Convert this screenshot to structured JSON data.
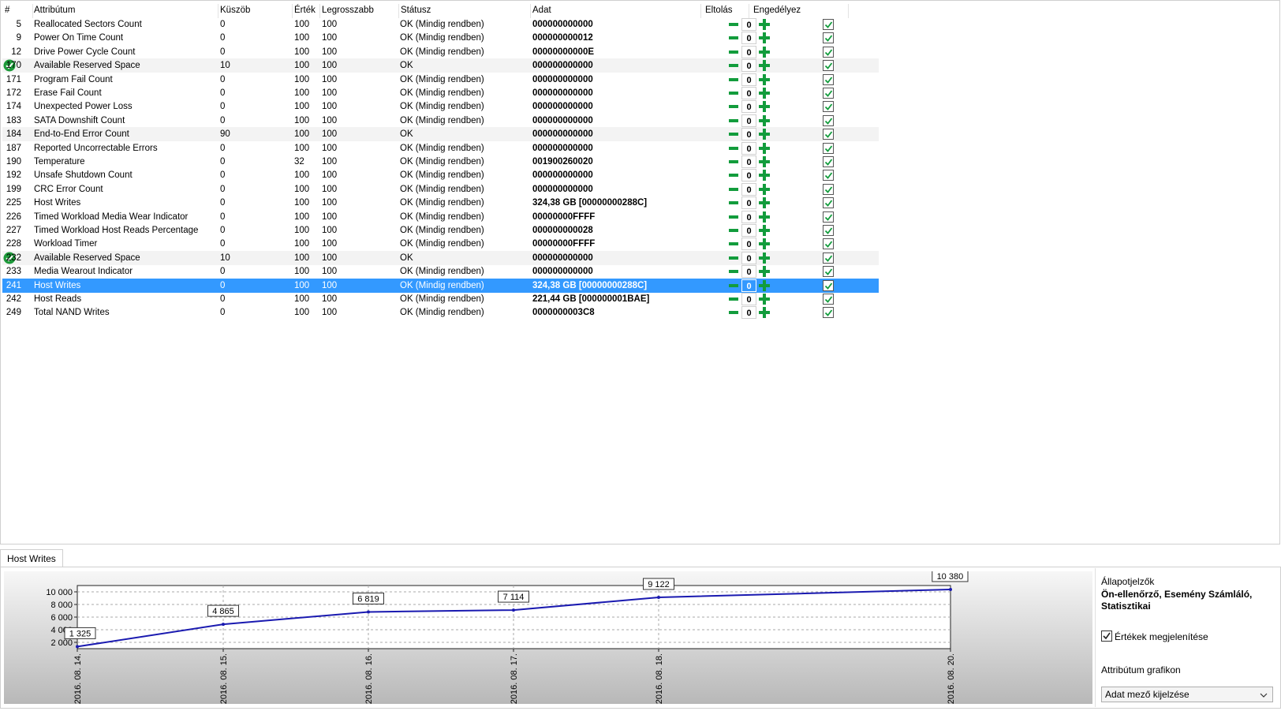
{
  "columns": [
    "#",
    "Attribútum",
    "Küszöb",
    "Érték",
    "Legrosszabb",
    "Státusz",
    "Adat",
    "Eltolás",
    "Engedélyez"
  ],
  "rows": [
    {
      "id": "5",
      "name": "Reallocated Sectors Count",
      "threshold": "0",
      "value": "100",
      "worst": "100",
      "status": "OK (Mindig rendben)",
      "data": "000000000000",
      "offset": "0",
      "enabled": true
    },
    {
      "id": "9",
      "name": "Power On Time Count",
      "threshold": "0",
      "value": "100",
      "worst": "100",
      "status": "OK (Mindig rendben)",
      "data": "000000000012",
      "offset": "0",
      "enabled": true
    },
    {
      "id": "12",
      "name": "Drive Power Cycle Count",
      "threshold": "0",
      "value": "100",
      "worst": "100",
      "status": "OK (Mindig rendben)",
      "data": "00000000000E",
      "offset": "0",
      "enabled": true
    },
    {
      "id": "170",
      "name": "Available Reserved Space",
      "threshold": "10",
      "value": "100",
      "worst": "100",
      "status": "OK",
      "data": "000000000000",
      "offset": "0",
      "enabled": true,
      "status_icon": "check-circle-icon"
    },
    {
      "id": "171",
      "name": "Program Fail Count",
      "threshold": "0",
      "value": "100",
      "worst": "100",
      "status": "OK (Mindig rendben)",
      "data": "000000000000",
      "offset": "0",
      "enabled": true
    },
    {
      "id": "172",
      "name": "Erase Fail Count",
      "threshold": "0",
      "value": "100",
      "worst": "100",
      "status": "OK (Mindig rendben)",
      "data": "000000000000",
      "offset": "0",
      "enabled": true
    },
    {
      "id": "174",
      "name": "Unexpected Power Loss",
      "threshold": "0",
      "value": "100",
      "worst": "100",
      "status": "OK (Mindig rendben)",
      "data": "000000000000",
      "offset": "0",
      "enabled": true
    },
    {
      "id": "183",
      "name": "SATA Downshift Count",
      "threshold": "0",
      "value": "100",
      "worst": "100",
      "status": "OK (Mindig rendben)",
      "data": "000000000000",
      "offset": "0",
      "enabled": true
    },
    {
      "id": "184",
      "name": "End-to-End Error Count",
      "threshold": "90",
      "value": "100",
      "worst": "100",
      "status": "OK",
      "data": "000000000000",
      "offset": "0",
      "enabled": true
    },
    {
      "id": "187",
      "name": "Reported Uncorrectable Errors",
      "threshold": "0",
      "value": "100",
      "worst": "100",
      "status": "OK (Mindig rendben)",
      "data": "000000000000",
      "offset": "0",
      "enabled": true
    },
    {
      "id": "190",
      "name": "Temperature",
      "threshold": "0",
      "value": "32",
      "worst": "100",
      "status": "OK (Mindig rendben)",
      "data": "001900260020",
      "offset": "0",
      "enabled": true
    },
    {
      "id": "192",
      "name": "Unsafe Shutdown Count",
      "threshold": "0",
      "value": "100",
      "worst": "100",
      "status": "OK (Mindig rendben)",
      "data": "000000000000",
      "offset": "0",
      "enabled": true
    },
    {
      "id": "199",
      "name": "CRC Error Count",
      "threshold": "0",
      "value": "100",
      "worst": "100",
      "status": "OK (Mindig rendben)",
      "data": "000000000000",
      "offset": "0",
      "enabled": true
    },
    {
      "id": "225",
      "name": "Host Writes",
      "threshold": "0",
      "value": "100",
      "worst": "100",
      "status": "OK (Mindig rendben)",
      "data": "324,38 GB [00000000288C]",
      "offset": "0",
      "enabled": true
    },
    {
      "id": "226",
      "name": "Timed Workload Media Wear Indicator",
      "threshold": "0",
      "value": "100",
      "worst": "100",
      "status": "OK (Mindig rendben)",
      "data": "00000000FFFF",
      "offset": "0",
      "enabled": true
    },
    {
      "id": "227",
      "name": "Timed Workload Host Reads Percentage",
      "threshold": "0",
      "value": "100",
      "worst": "100",
      "status": "OK (Mindig rendben)",
      "data": "000000000028",
      "offset": "0",
      "enabled": true
    },
    {
      "id": "228",
      "name": "Workload Timer",
      "threshold": "0",
      "value": "100",
      "worst": "100",
      "status": "OK (Mindig rendben)",
      "data": "00000000FFFF",
      "offset": "0",
      "enabled": true
    },
    {
      "id": "232",
      "name": "Available Reserved Space",
      "threshold": "10",
      "value": "100",
      "worst": "100",
      "status": "OK",
      "data": "000000000000",
      "offset": "0",
      "enabled": true,
      "status_icon": "check-circle-icon"
    },
    {
      "id": "233",
      "name": "Media Wearout Indicator",
      "threshold": "0",
      "value": "100",
      "worst": "100",
      "status": "OK (Mindig rendben)",
      "data": "000000000000",
      "offset": "0",
      "enabled": true
    },
    {
      "id": "241",
      "name": "Host Writes",
      "threshold": "0",
      "value": "100",
      "worst": "100",
      "status": "OK (Mindig rendben)",
      "data": "324,38 GB [00000000288C]",
      "offset": "0",
      "enabled": true,
      "selected": true
    },
    {
      "id": "242",
      "name": "Host Reads",
      "threshold": "0",
      "value": "100",
      "worst": "100",
      "status": "OK (Mindig rendben)",
      "data": "221,44 GB [000000001BAE]",
      "offset": "0",
      "enabled": true
    },
    {
      "id": "249",
      "name": "Total NAND Writes",
      "threshold": "0",
      "value": "100",
      "worst": "100",
      "status": "OK (Mindig rendben)",
      "data": "0000000003C8",
      "offset": "0",
      "enabled": true
    }
  ],
  "bottom_tab": {
    "label": "Host Writes"
  },
  "side_panel": {
    "title": "Állapotjelzők",
    "flags": "Ön-ellenőrző, Esemény Számláló, Statisztikai",
    "show_values_label": "Értékek megjelenítése",
    "show_values_checked": true,
    "graph_label": "Attribútum grafikon",
    "graph_select_value": "Adat mező kijelzése"
  },
  "colors": {
    "selection": "#3399ff",
    "ok_green": "#129c3c",
    "line": "#1a1ab0"
  },
  "chart_data": {
    "type": "line",
    "x": [
      "2016. 08. 14.",
      "2016. 08. 15.",
      "2016. 08. 16.",
      "2016. 08. 17.",
      "2016. 08. 18.",
      "2016. 08. 20."
    ],
    "y": [
      1325,
      4865,
      6819,
      7114,
      9122,
      10380
    ],
    "point_labels": [
      "1 325",
      "4 865",
      "6 819",
      "7 114",
      "9 122",
      "10 380"
    ],
    "y_ticks": [
      "2 000",
      "4 000",
      "6 000",
      "8 000",
      "10 000"
    ],
    "y_tick_values": [
      2000,
      4000,
      6000,
      8000,
      10000
    ],
    "ylim": [
      1000,
      11000
    ],
    "grid": true
  }
}
